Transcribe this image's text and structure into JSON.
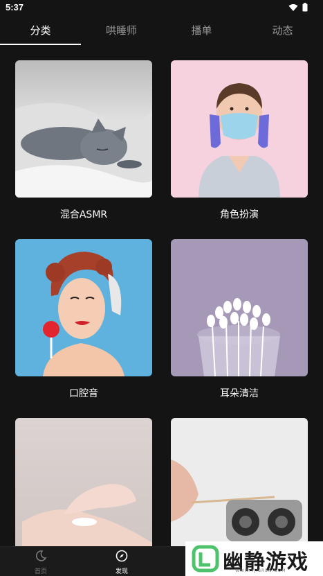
{
  "status": {
    "time": "5:37"
  },
  "tabs": [
    {
      "label": "分类",
      "active": true
    },
    {
      "label": "哄睡师",
      "active": false
    },
    {
      "label": "播单",
      "active": false
    },
    {
      "label": "动态",
      "active": false
    }
  ],
  "categories": [
    {
      "label": "混合ASMR",
      "image": "sleeping-gray-cat"
    },
    {
      "label": "角色扮演",
      "image": "nurse-with-mask"
    },
    {
      "label": "口腔音",
      "image": "woman-with-lollipop"
    },
    {
      "label": "耳朵清洁",
      "image": "cotton-swabs-glass"
    },
    {
      "label": "",
      "image": "hands-with-lotion"
    },
    {
      "label": "",
      "image": "cotton-swab-microphone"
    }
  ],
  "bottom_nav": [
    {
      "label": "首页",
      "icon": "moon-icon",
      "active": false
    },
    {
      "label": "发现",
      "icon": "compass-icon",
      "active": true
    }
  ],
  "watermark": {
    "text": "幽静游戏",
    "url": "WWW.YJISREN.COM"
  },
  "colors": {
    "background": "#141414",
    "accent_green": "#4fc36b"
  }
}
